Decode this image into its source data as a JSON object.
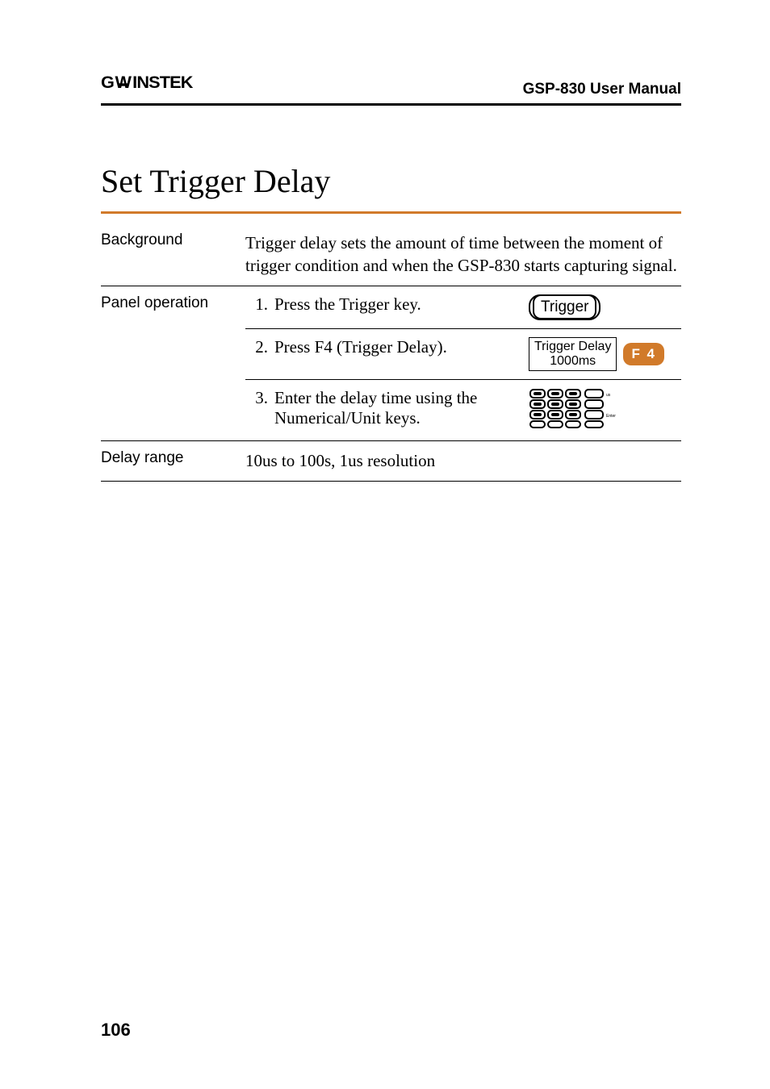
{
  "header": {
    "logo_text": "GWINSTEK",
    "manual": "GSP-830 User Manual"
  },
  "section_title": "Set Trigger Delay",
  "rows": {
    "background": {
      "label": "Background",
      "text": "Trigger delay sets the amount of time between the moment of trigger condition and when the GSP-830 starts capturing signal."
    },
    "panel": {
      "label": "Panel operation",
      "step1_num": "1.",
      "step1_text": "Press the Trigger key.",
      "step1_key_label": "Trigger",
      "step2_num": "2.",
      "step2_text": "Press F4 (Trigger Delay).",
      "step2_soft_line1": "Trigger Delay",
      "step2_soft_line2": "1000ms",
      "step2_fkey": "F 4",
      "step3_num": "3.",
      "step3_text": "Enter the delay time using the Numerical/Unit keys."
    },
    "delay_range": {
      "label": "Delay range",
      "text": "10us to 100s, 1us resolution"
    }
  },
  "page_number": "106"
}
